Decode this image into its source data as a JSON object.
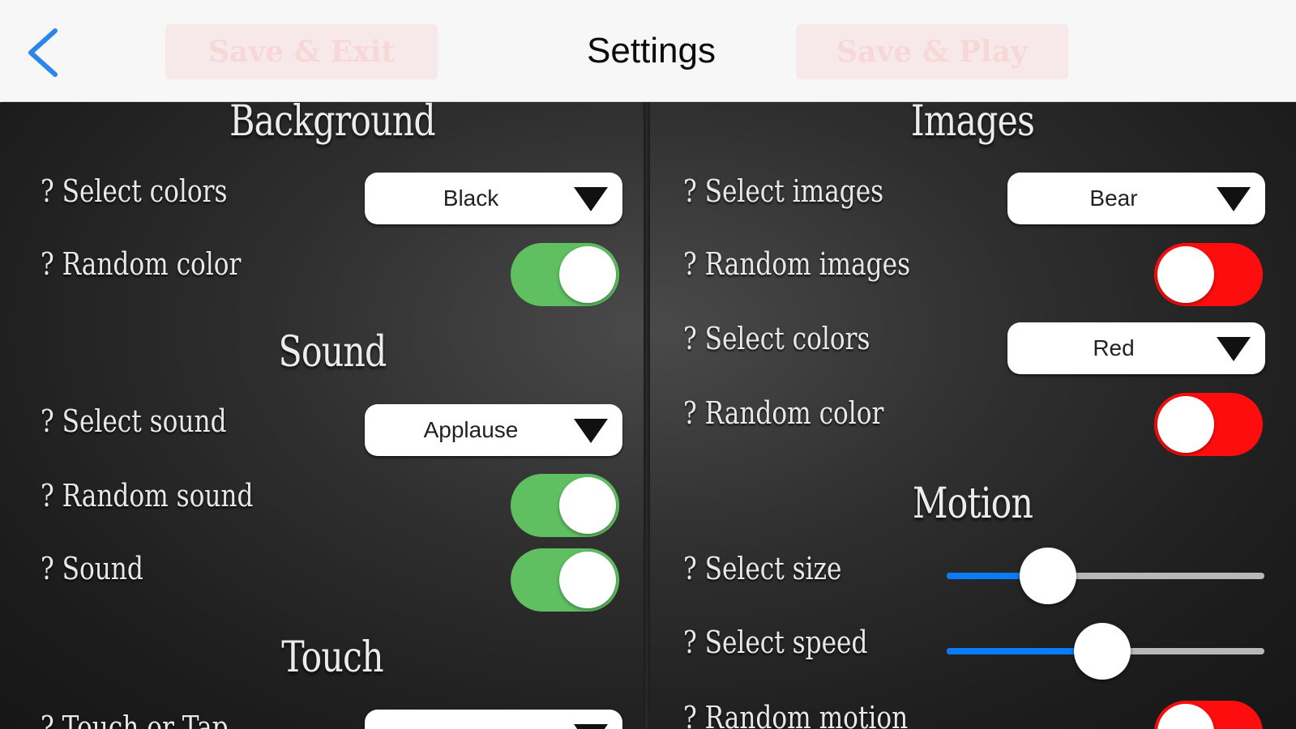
{
  "navbar": {
    "title": "Settings",
    "save_exit_label": "Save & Exit",
    "save_play_label": "Save & Play"
  },
  "left": {
    "background": {
      "heading": "Background",
      "select_colors_label": "? Select colors",
      "select_colors_value": "Black",
      "random_color_label": "? Random color",
      "random_color_on": true
    },
    "sound": {
      "heading": "Sound",
      "select_sound_label": "? Select sound",
      "select_sound_value": "Applause",
      "random_sound_label": "? Random sound",
      "random_sound_on": true,
      "sound_label": "? Sound",
      "sound_on": true
    },
    "touch": {
      "heading": "Touch",
      "touch_or_tap_label": "? Touch or Tap"
    }
  },
  "right": {
    "images": {
      "heading": "Images",
      "select_images_label": "? Select images",
      "select_images_value": "Bear",
      "random_images_label": "? Random images",
      "random_images_on": false,
      "select_colors_label": "? Select colors",
      "select_colors_value": "Red",
      "random_color_label": "? Random color",
      "random_color_on": false
    },
    "motion": {
      "heading": "Motion",
      "select_size_label": "? Select size",
      "select_size_value": 0.32,
      "select_speed_label": "? Select speed",
      "select_speed_value": 0.49,
      "random_motion_label": "? Random motion",
      "random_motion_on": false
    }
  },
  "colors": {
    "toggle_on": "#5fbf61",
    "toggle_off": "#fd0d0d",
    "slider_fill": "#0a7cf5",
    "back_chevron": "#2b86e8"
  }
}
